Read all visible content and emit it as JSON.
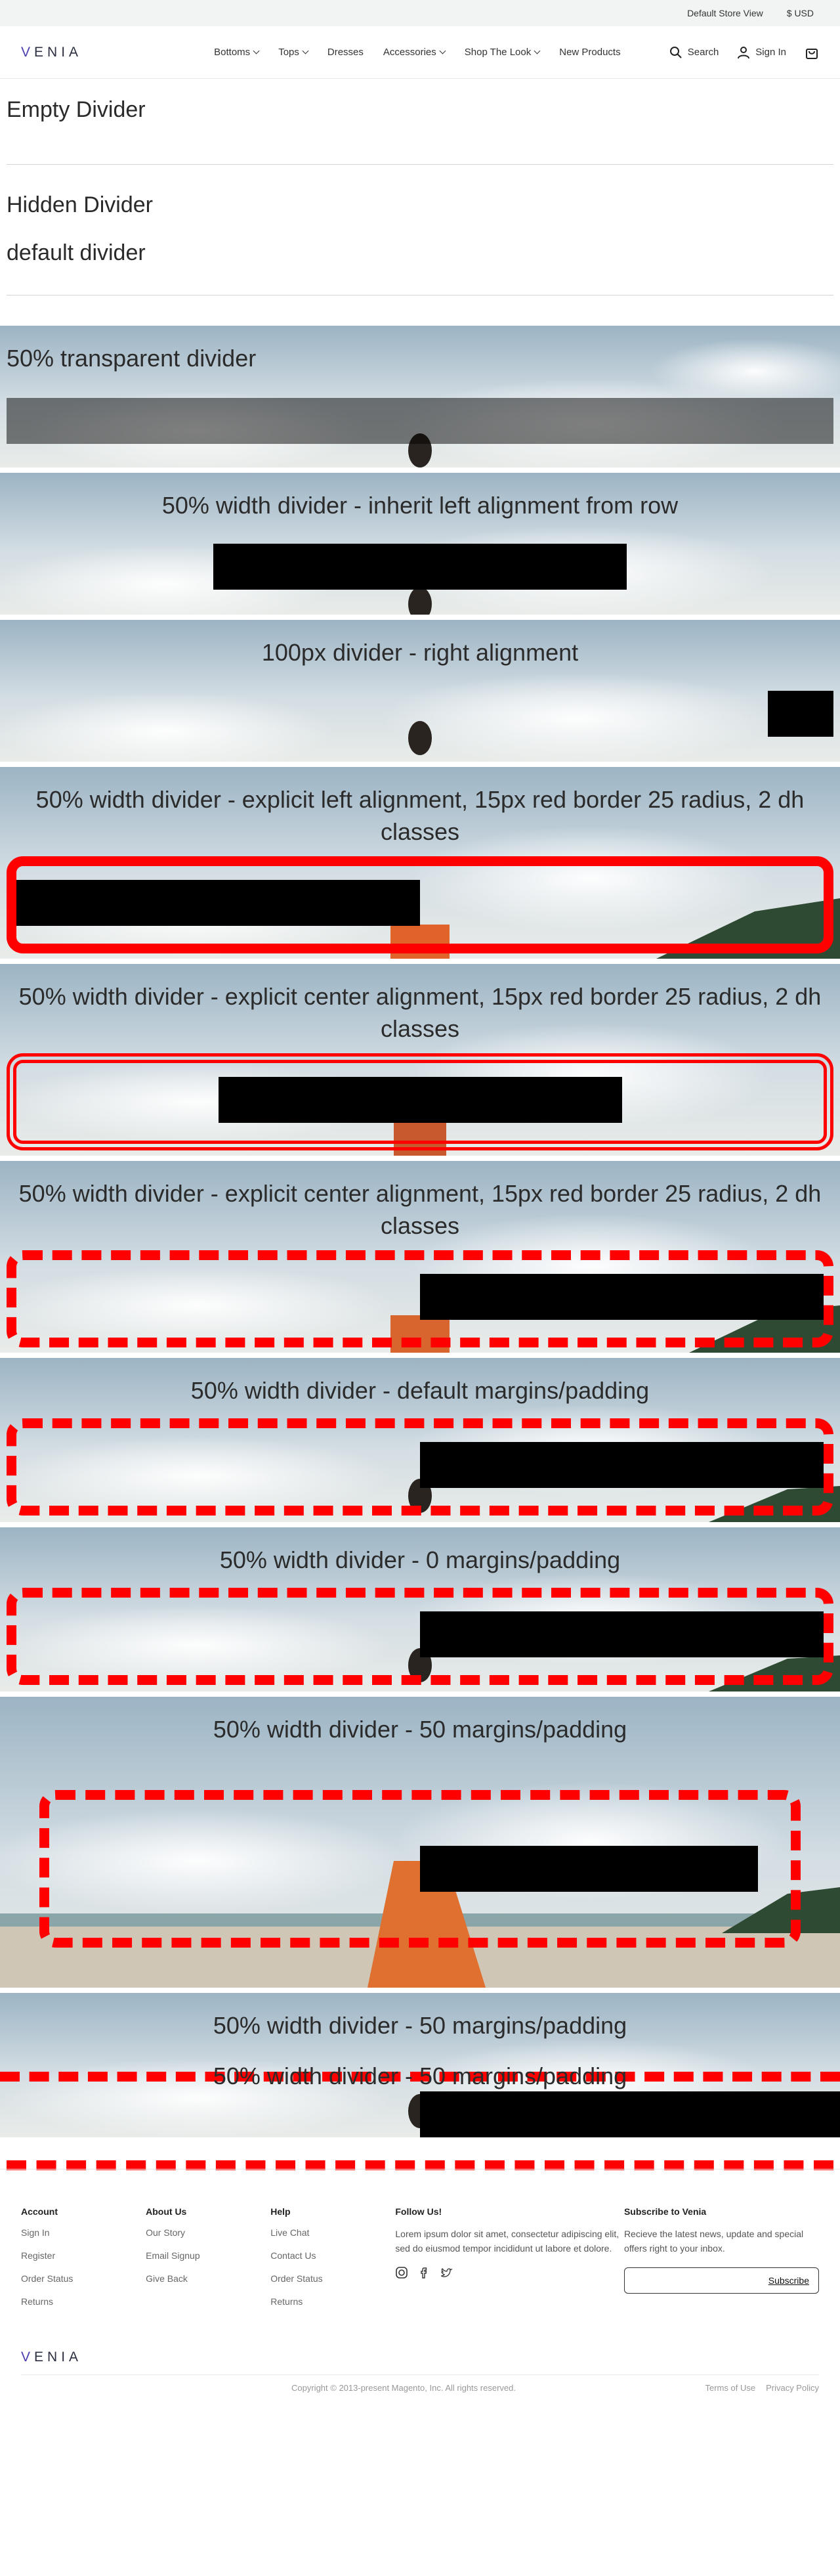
{
  "topbar": {
    "store_view": "Default Store View",
    "currency": "$ USD"
  },
  "header": {
    "logo": "VENIA",
    "nav": [
      {
        "label": "Bottoms",
        "dropdown": true
      },
      {
        "label": "Tops",
        "dropdown": true
      },
      {
        "label": "Dresses",
        "dropdown": false
      },
      {
        "label": "Accessories",
        "dropdown": true
      },
      {
        "label": "Shop The Look",
        "dropdown": true
      },
      {
        "label": "New Products",
        "dropdown": false
      }
    ],
    "search_label": "Search",
    "signin_label": "Sign In"
  },
  "simple": {
    "empty_divider": "Empty Divider",
    "hidden_divider": "Hidden Divider",
    "default_divider": "default divider"
  },
  "rows": [
    {
      "title": "50% transparent divider"
    },
    {
      "title": "50% width divider - inherit left alignment from row"
    },
    {
      "title": "100px divider - right alignment"
    },
    {
      "title": "50% width divider - explicit left alignment, 15px red border 25 radius, 2 dh classes"
    },
    {
      "title": "50% width divider - explicit center alignment, 15px red border 25 radius, 2 dh classes"
    },
    {
      "title": "50% width divider - explicit center alignment, 15px red border 25 radius, 2 dh classes"
    },
    {
      "title": "50% width divider - default margins/padding"
    },
    {
      "title": "50% width divider - 0 margins/padding"
    },
    {
      "title": "50% width divider - 50 margins/padding"
    },
    {
      "title": "50% width divider - 50 margins/padding",
      "overlay": "50% width divider - 50 margins/padding"
    }
  ],
  "footer": {
    "columns": [
      {
        "heading": "Account",
        "links": [
          "Sign In",
          "Register",
          "Order Status",
          "Returns"
        ]
      },
      {
        "heading": "About Us",
        "links": [
          "Our Story",
          "Email Signup",
          "Give Back"
        ]
      },
      {
        "heading": "Help",
        "links": [
          "Live Chat",
          "Contact Us",
          "Order Status",
          "Returns"
        ]
      }
    ],
    "follow": {
      "heading": "Follow Us!",
      "text": "Lorem ipsum dolor sit amet, consectetur adipiscing elit, sed do eiusmod tempor incididunt ut labore et dolore.",
      "socials": [
        "instagram-icon",
        "facebook-icon",
        "twitter-icon"
      ]
    },
    "subscribe": {
      "heading": "Subscribe to Venia",
      "text": "Recieve the latest news, update and special offers right to your inbox.",
      "button": "Subscribe"
    },
    "logo": "VENIA",
    "copyright": "Copyright © 2013-present Magento, Inc. All rights reserved.",
    "legal": [
      "Terms of Use",
      "Privacy Policy"
    ]
  },
  "colors": {
    "accent": "#4b3fb0",
    "red_border": "#ff0000",
    "divider_black": "#000000"
  }
}
